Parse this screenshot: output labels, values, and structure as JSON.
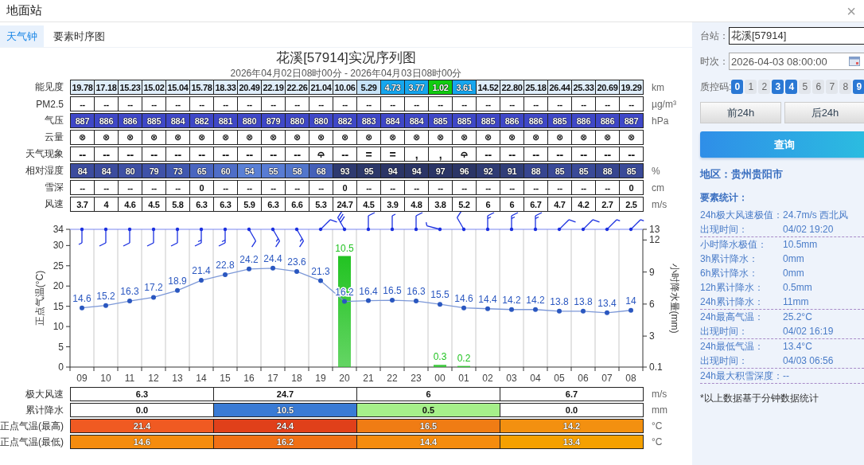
{
  "window": {
    "title": "地面站",
    "close": "×"
  },
  "tabs": [
    {
      "label": "天气钟",
      "selected": true
    },
    {
      "label": "要素时序图",
      "selected": false
    }
  ],
  "chart_title": "花溪[57914]实况序列图",
  "chart_subtitle": "2026年04月02日08时00分 - 2026年04月03日08时00分",
  "table": {
    "rows": [
      {
        "label": "能见度",
        "unit": "km",
        "cells": [
          {
            "text": "19.78",
            "color": "#e0eefb"
          },
          {
            "text": "17.18",
            "color": "#e0eefb"
          },
          {
            "text": "15.23",
            "color": "#e0eefb"
          },
          {
            "text": "15.02",
            "color": "#e0eefb"
          },
          {
            "text": "15.04",
            "color": "#e0eefb"
          },
          {
            "text": "15.78",
            "color": "#e0eefb"
          },
          {
            "text": "18.33",
            "color": "#e0eefb"
          },
          {
            "text": "20.49",
            "color": "#e0eefb"
          },
          {
            "text": "22.19",
            "color": "#e0eefb"
          },
          {
            "text": "22.26",
            "color": "#e0eefb"
          },
          {
            "text": "21.04",
            "color": "#e0eefb"
          },
          {
            "text": "10.06",
            "color": "#e0eefb"
          },
          {
            "text": "5.29",
            "color": "#c6e3f8"
          },
          {
            "text": "4.73",
            "color": "#16a6ee"
          },
          {
            "text": "3.77",
            "color": "#16a6ee"
          },
          {
            "text": "1.02",
            "color": "#11cc11"
          },
          {
            "text": "3.61",
            "color": "#16a6ee"
          },
          {
            "text": "14.52",
            "color": "#e0eefb"
          },
          {
            "text": "22.80",
            "color": "#e0eefb"
          },
          {
            "text": "25.18",
            "color": "#e0eefb"
          },
          {
            "text": "26.44",
            "color": "#e0eefb"
          },
          {
            "text": "25.33",
            "color": "#e0eefb"
          },
          {
            "text": "20.69",
            "color": "#e0eefb"
          },
          {
            "text": "19.29",
            "color": "#e0eefb"
          }
        ]
      },
      {
        "label": "PM2.5",
        "unit": "µg/m³",
        "cells": [
          "--",
          "--",
          "--",
          "--",
          "--",
          "--",
          "--",
          "--",
          "--",
          "--",
          "--",
          "--",
          "--",
          "--",
          "--",
          "--",
          "--",
          "--",
          "--",
          "--",
          "--",
          "--",
          "--",
          "--"
        ]
      },
      {
        "label": "气压",
        "unit": "hPa",
        "cells": [
          {
            "text": "887",
            "color": "#3f48c8"
          },
          {
            "text": "886",
            "color": "#3f48c8"
          },
          {
            "text": "886",
            "color": "#3f48c8"
          },
          {
            "text": "885",
            "color": "#3f48c8"
          },
          {
            "text": "884",
            "color": "#3f48c8"
          },
          {
            "text": "882",
            "color": "#3f48c8"
          },
          {
            "text": "881",
            "color": "#3f48c8"
          },
          {
            "text": "880",
            "color": "#3f48c8"
          },
          {
            "text": "879",
            "color": "#3f48c8"
          },
          {
            "text": "880",
            "color": "#3f48c8"
          },
          {
            "text": "880",
            "color": "#3f48c8"
          },
          {
            "text": "882",
            "color": "#3f48c8"
          },
          {
            "text": "883",
            "color": "#3f48c8"
          },
          {
            "text": "884",
            "color": "#3f48c8"
          },
          {
            "text": "884",
            "color": "#3f48c8"
          },
          {
            "text": "885",
            "color": "#3f48c8"
          },
          {
            "text": "885",
            "color": "#3f48c8"
          },
          {
            "text": "885",
            "color": "#3f48c8"
          },
          {
            "text": "886",
            "color": "#3f48c8"
          },
          {
            "text": "886",
            "color": "#3f48c8"
          },
          {
            "text": "885",
            "color": "#3f48c8"
          },
          {
            "text": "886",
            "color": "#3f48c8"
          },
          {
            "text": "886",
            "color": "#3f48c8"
          },
          {
            "text": "887",
            "color": "#3f48c8"
          }
        ]
      },
      {
        "label": "云量",
        "cells": [
          "⊗",
          "⊗",
          "⊗",
          "⊗",
          "⊗",
          "⊗",
          "⊗",
          "⊗",
          "⊗",
          "⊗",
          "⊗",
          "⊗",
          "⊗",
          "⊗",
          "⊗",
          "⊗",
          "⊗",
          "⊗",
          "⊗",
          "⊗",
          "⊗",
          "⊗",
          "⊗",
          "⊗"
        ]
      },
      {
        "label": "天气现象",
        "cells": [
          {
            "kind": "text",
            "text": "--"
          },
          {
            "kind": "text",
            "text": "--"
          },
          {
            "kind": "text",
            "text": "--"
          },
          {
            "kind": "text",
            "text": "--"
          },
          {
            "kind": "text",
            "text": "--"
          },
          {
            "kind": "text",
            "text": "--"
          },
          {
            "kind": "text",
            "text": "--"
          },
          {
            "kind": "text",
            "text": "--"
          },
          {
            "kind": "text",
            "text": "--"
          },
          {
            "kind": "text",
            "text": "--"
          },
          {
            "kind": "icon"
          },
          {
            "kind": "text",
            "text": "--"
          },
          {
            "kind": "text",
            "text": "="
          },
          {
            "kind": "text",
            "text": "="
          },
          {
            "kind": "text",
            "text": ","
          },
          {
            "kind": "text",
            "text": ","
          },
          {
            "kind": "icon"
          },
          {
            "kind": "text",
            "text": "--"
          },
          {
            "kind": "text",
            "text": "--"
          },
          {
            "kind": "text",
            "text": "--"
          },
          {
            "kind": "text",
            "text": "--"
          },
          {
            "kind": "text",
            "text": "--"
          },
          {
            "kind": "text",
            "text": "--"
          },
          {
            "kind": "text",
            "text": "--"
          }
        ]
      },
      {
        "label": "相对湿度",
        "unit": "%",
        "cells": [
          {
            "text": "84",
            "color": "#3c4c9e"
          },
          {
            "text": "84",
            "color": "#3c4c9e"
          },
          {
            "text": "80",
            "color": "#3e50a4"
          },
          {
            "text": "79",
            "color": "#3f52a8"
          },
          {
            "text": "73",
            "color": "#4058b0"
          },
          {
            "text": "65",
            "color": "#4a66c0"
          },
          {
            "text": "60",
            "color": "#4f6ec8"
          },
          {
            "text": "54",
            "color": "#5a80d6"
          },
          {
            "text": "55",
            "color": "#587cd4"
          },
          {
            "text": "58",
            "color": "#5276cc"
          },
          {
            "text": "68",
            "color": "#4560b8"
          },
          {
            "text": "93",
            "color": "#2e3a70"
          },
          {
            "text": "95",
            "color": "#2c386a"
          },
          {
            "text": "94",
            "color": "#2b3566"
          },
          {
            "text": "94",
            "color": "#2b3566"
          },
          {
            "text": "97",
            "color": "#2b3566"
          },
          {
            "text": "96",
            "color": "#2b3566"
          },
          {
            "text": "92",
            "color": "#2f3c74"
          },
          {
            "text": "91",
            "color": "#303e78"
          },
          {
            "text": "88",
            "color": "#374690"
          },
          {
            "text": "85",
            "color": "#3a4a98"
          },
          {
            "text": "85",
            "color": "#3a4a98"
          },
          {
            "text": "88",
            "color": "#374690"
          },
          {
            "text": "85",
            "color": "#3a4a98"
          }
        ]
      },
      {
        "label": "雪深",
        "unit": "cm",
        "cells": [
          "--",
          "--",
          "--",
          "--",
          "--",
          "0",
          "--",
          "--",
          "--",
          "--",
          "--",
          "0",
          "--",
          "--",
          "--",
          "--",
          "--",
          "--",
          "--",
          "--",
          "--",
          "--",
          "--",
          "0"
        ]
      },
      {
        "label": "风速",
        "unit": "m/s",
        "cells": [
          "3.7",
          "4",
          "4.6",
          "4.5",
          "5.8",
          "6.3",
          "6.3",
          "5.9",
          "6.3",
          "6.6",
          "5.3",
          "24.7",
          "4.5",
          "3.9",
          "4.8",
          "3.8",
          "5.2",
          "6",
          "6",
          "6.7",
          "4.7",
          "4.2",
          "2.7",
          "2.5"
        ]
      }
    ]
  },
  "chart_data": {
    "type": "line",
    "ylabel": "正点气温(°C)",
    "y2label": "小时降水量(mm)",
    "categories": [
      "09",
      "10",
      "11",
      "12",
      "13",
      "14",
      "15",
      "16",
      "17",
      "18",
      "19",
      "20",
      "21",
      "22",
      "23",
      "00",
      "01",
      "02",
      "03",
      "04",
      "05",
      "06",
      "07",
      "08"
    ],
    "series": [
      {
        "marker": true,
        "color": "#2a57c0",
        "values": [
          14.6,
          15.2,
          16.3,
          17.2,
          18.9,
          21.4,
          22.8,
          24.2,
          24.4,
          23.6,
          21.3,
          16.2,
          16.4,
          16.5,
          16.3,
          15.5,
          14.6,
          14.4,
          14.2,
          14.2,
          13.8,
          13.8,
          13.4,
          14
        ]
      },
      {
        "type": "bar",
        "axis": "y2",
        "color": "#22c322",
        "values": [
          null,
          null,
          null,
          null,
          null,
          null,
          null,
          null,
          null,
          null,
          null,
          10.5,
          null,
          null,
          null,
          0.3,
          0.2,
          null,
          null,
          null,
          null,
          null,
          null,
          null
        ]
      }
    ],
    "ylim": [
      0,
      34
    ],
    "yticks": [
      0,
      5,
      10,
      15,
      20,
      25,
      30,
      34
    ],
    "y2lim": [
      0.1,
      13
    ],
    "y2ticks": [
      0.1,
      3,
      6,
      9,
      12,
      13
    ],
    "data_labels": true
  },
  "wind_barbs": [
    {
      "kind": "south"
    },
    {
      "kind": "south"
    },
    {
      "kind": "south"
    },
    {
      "kind": "south"
    },
    {
      "kind": "south"
    },
    {
      "kind": "south"
    },
    {
      "kind": "south"
    },
    {
      "kind": "southeast"
    },
    {
      "kind": "southeast"
    },
    {
      "kind": "southeast"
    },
    {
      "kind": "northeast"
    },
    {
      "kind": "northwest"
    },
    {
      "kind": "north"
    },
    {
      "kind": "north"
    },
    {
      "kind": "north"
    },
    {
      "kind": "west"
    },
    {
      "kind": "northwest"
    },
    {
      "kind": "north"
    },
    {
      "kind": "north"
    },
    {
      "kind": "north"
    },
    {
      "kind": "northeast"
    },
    {
      "kind": "northeast"
    },
    {
      "kind": "northeast"
    },
    {
      "kind": "northeast"
    }
  ],
  "summary": {
    "rows": [
      {
        "label": "极大风速",
        "unit": "m/s",
        "cells": [
          {
            "text": "6.3",
            "color": "#ffffff"
          },
          {
            "text": "24.7",
            "color": "#ffffff"
          },
          {
            "text": "6",
            "color": "#ffffff"
          },
          {
            "text": "6.7",
            "color": "#ffffff"
          }
        ]
      },
      {
        "label": "累计降水",
        "unit": "mm",
        "cells": [
          {
            "text": "0.0",
            "color": "#ffffff"
          },
          {
            "text": "10.5",
            "color": "#3a7bd5"
          },
          {
            "text": "0.5",
            "color": "#a6f08a"
          },
          {
            "text": "0.0",
            "color": "#ffffff"
          }
        ]
      },
      {
        "label": "正点气温(最高)",
        "unit": "°C",
        "cells": [
          {
            "text": "21.4",
            "color": "#f05a22"
          },
          {
            "text": "24.4",
            "color": "#e0401a"
          },
          {
            "text": "16.5",
            "color": "#f07c14"
          },
          {
            "text": "14.2",
            "color": "#f39010"
          }
        ]
      },
      {
        "label": "正点气温(最低)",
        "unit": "°C",
        "cells": [
          {
            "text": "14.6",
            "color": "#f58c0e"
          },
          {
            "text": "16.2",
            "color": "#f07015"
          },
          {
            "text": "14.4",
            "color": "#f58c0e"
          },
          {
            "text": "13.4",
            "color": "#f5a000"
          }
        ]
      }
    ]
  },
  "panel": {
    "station": {
      "label": "台站：",
      "value": "花溪[57914]"
    },
    "time": {
      "label": "时次：",
      "value": "2026-04-03 08:00:00"
    },
    "qc": {
      "label": "质控码:",
      "codes": [
        {
          "label": "0",
          "selected": true
        },
        {
          "label": "1",
          "selected": false
        },
        {
          "label": "2",
          "selected": false
        },
        {
          "label": "3",
          "selected": true
        },
        {
          "label": "4",
          "selected": true
        },
        {
          "label": "5",
          "selected": false
        },
        {
          "label": "6",
          "selected": false
        },
        {
          "label": "7",
          "selected": false
        },
        {
          "label": "8",
          "selected": false
        },
        {
          "label": "9",
          "selected": true
        }
      ]
    },
    "nav_buttons": [
      "前24h",
      "后24h"
    ],
    "query_button": "查询",
    "region": "地区：贵州贵阳市",
    "stats_title": "要素统计：",
    "stat_groups": [
      [
        {
          "label": "24h极大风速极值：",
          "value": "24.7m/s 西北风"
        },
        {
          "label": "出现时间：",
          "value": "04/02 19:20"
        }
      ],
      [
        {
          "label": "小时降水极值：",
          "value": "10.5mm"
        },
        {
          "label": "3h累计降水：",
          "value": "0mm"
        },
        {
          "label": "6h累计降水：",
          "value": "0mm"
        },
        {
          "label": "12h累计降水：",
          "value": "0.5mm"
        },
        {
          "label": "24h累计降水：",
          "value": "11mm"
        }
      ],
      [
        {
          "label": "24h最高气温：",
          "value": "25.2°C"
        },
        {
          "label": "出现时间：",
          "value": "04/02 16:19"
        }
      ],
      [
        {
          "label": "24h最低气温：",
          "value": "13.4°C"
        },
        {
          "label": "出现时间：",
          "value": "04/03 06:56"
        }
      ],
      [
        {
          "label": "24h最大积雪深度：",
          "value": "--"
        }
      ]
    ],
    "footnote": "*以上数据基于分钟数据统计"
  }
}
